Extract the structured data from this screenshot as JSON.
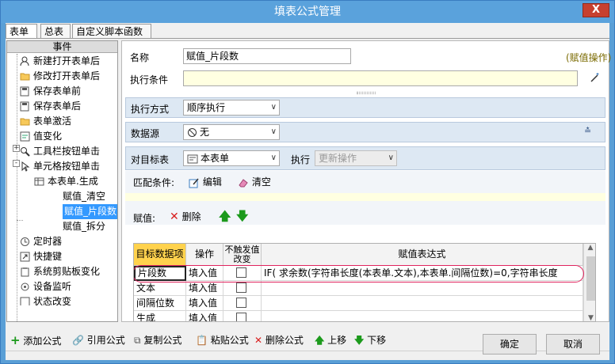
{
  "window": {
    "title": "填表公式管理",
    "close_label": "X"
  },
  "tabs": [
    "表单",
    "总表",
    "自定义脚本函数"
  ],
  "tree": {
    "header": "事件",
    "items": [
      "新建打开表单后",
      "修改打开表单后",
      "保存表单前",
      "保存表单后",
      "表单激活",
      "值变化",
      "工具栏按钮单击",
      "单元格按钮单击",
      "本表单.生成",
      "赋值_清空",
      "赋值_片段数",
      "赋值_拆分",
      "定时器",
      "快捷键",
      "系统剪贴板变化",
      "设备监听",
      "状态改变"
    ]
  },
  "form": {
    "name_label": "名称",
    "name_value": "赋值_片段数",
    "assign_op": "(赋值操作)",
    "cond_label": "执行条件",
    "cond_value": "",
    "mode_label": "执行方式",
    "mode_value": "顺序执行",
    "source_label": "数据源",
    "source_value": "无",
    "target_label": "对目标表",
    "target_value": "本表单",
    "exec_label": "执行",
    "exec_value": "更新操作",
    "match_label": "匹配条件:",
    "edit_label": "编辑",
    "clear_label": "清空",
    "assign_label": "赋值:",
    "delete_label": "删除"
  },
  "grid": {
    "headers": [
      "目标数据项",
      "操作",
      "不触发值改变",
      "赋值表达式"
    ],
    "rows": [
      {
        "field": "片段数",
        "op": "填入值",
        "expr": "IF( 求余数(字符串长度(本表单.文本),本表单.间隔位数)=0,字符串长度"
      },
      {
        "field": "文本",
        "op": "填入值",
        "expr": ""
      },
      {
        "field": "间隔位数",
        "op": "填入值",
        "expr": ""
      },
      {
        "field": "生成",
        "op": "填入值",
        "expr": ""
      }
    ]
  },
  "toolbar": [
    "添加公式",
    "引用公式",
    "复制公式",
    "粘贴公式",
    "删除公式",
    "上移",
    "下移"
  ],
  "buttons": {
    "ok": "确定",
    "cancel": "取消"
  },
  "colors": {
    "title_bar": "#5aa2dc",
    "selected": "#3399ff",
    "section": "#dde8f3",
    "highlight_ring": "#e0245e",
    "cond_bg": "#ffffe1"
  }
}
